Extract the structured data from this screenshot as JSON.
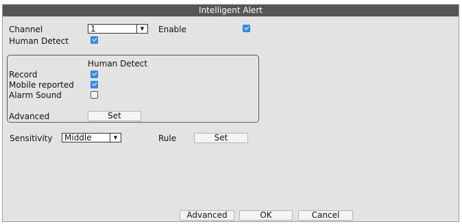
{
  "window": {
    "title": "Intelligent Alert"
  },
  "channel": {
    "label": "Channel",
    "value": "1"
  },
  "enable": {
    "label": "Enable",
    "checked": true
  },
  "human_detect": {
    "label": "Human Detect",
    "checked": true
  },
  "group": {
    "title": "Human Detect",
    "record": {
      "label": "Record",
      "checked": true
    },
    "mobile_reported": {
      "label": "Mobile reported",
      "checked": true
    },
    "alarm_sound": {
      "label": "Alarm Sound",
      "checked": false
    },
    "advanced": {
      "label": "Advanced",
      "button": "Set"
    }
  },
  "sensitivity": {
    "label": "Sensitivity",
    "value": "Middle"
  },
  "rule": {
    "label": "Rule",
    "button": "Set"
  },
  "footer": {
    "advanced": "Advanced",
    "ok": "OK",
    "cancel": "Cancel"
  },
  "icons": {
    "dropdown": "chevron-down-icon",
    "checkbox": "checkmark-icon"
  },
  "colors": {
    "titlebar": "#555657",
    "panel": "#e3e3e3",
    "checkbox_on": "#3a8ee8"
  }
}
